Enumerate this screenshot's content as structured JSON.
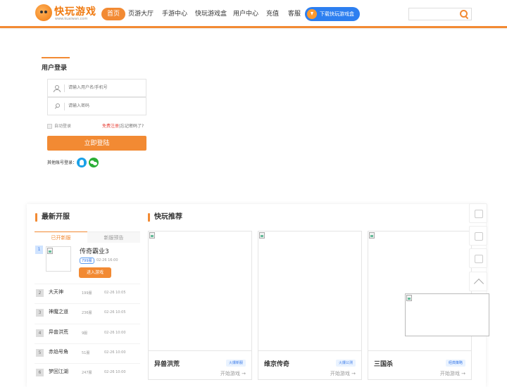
{
  "header": {
    "logo_text": "快玩游戏",
    "logo_sub": "www.kuaiwan.com",
    "nav": [
      "首页",
      "页游大厅",
      "手游中心",
      "快玩游戏盒",
      "用户中心",
      "充值",
      "客服"
    ],
    "download_label": "下载快玩游戏盒",
    "search_placeholder": ""
  },
  "login": {
    "title": "用户登录",
    "username_placeholder": "请输入用户名/手机号",
    "password_placeholder": "请输入密码",
    "remember_label": "自动登录",
    "register_link": "免费注册",
    "separator": "|",
    "forgot_link": "忘记密码了?",
    "submit_label": "立即登陆",
    "other_label": "其他账号登录："
  },
  "servers": {
    "title": "最新开服",
    "tabs": [
      "已开新服",
      "新服预告"
    ],
    "featured": {
      "rank": "1",
      "name": "传奇霸业3",
      "server": "799服",
      "time": "02-26 16:00",
      "button": "进入游戏"
    },
    "rows": [
      {
        "rank": "2",
        "name": "大天神",
        "server": "199服",
        "time": "02-26 10:05"
      },
      {
        "rank": "3",
        "name": "神魔之道",
        "server": "236服",
        "time": "02-26 10:05"
      },
      {
        "rank": "4",
        "name": "异兽洪荒",
        "server": "9服",
        "time": "02-26 10:00"
      },
      {
        "rank": "5",
        "name": "赤焰号角",
        "server": "51服",
        "time": "02-26 10:00"
      },
      {
        "rank": "6",
        "name": "梦回江湖",
        "server": "247服",
        "time": "02-26 10:00"
      }
    ]
  },
  "recommend": {
    "title": "快玩推荐",
    "cards": [
      {
        "name": "异兽洪荒",
        "tag": "火爆新服",
        "play": "开始游戏 →"
      },
      {
        "name": "维京传奇",
        "tag": "火爆公测",
        "play": "开始游戏 →"
      },
      {
        "name": "三国杀",
        "tag": "经典策略",
        "play": "开始游戏 →"
      }
    ]
  },
  "colors": {
    "accent": "#f28a33",
    "blue": "#2d7ff0"
  }
}
